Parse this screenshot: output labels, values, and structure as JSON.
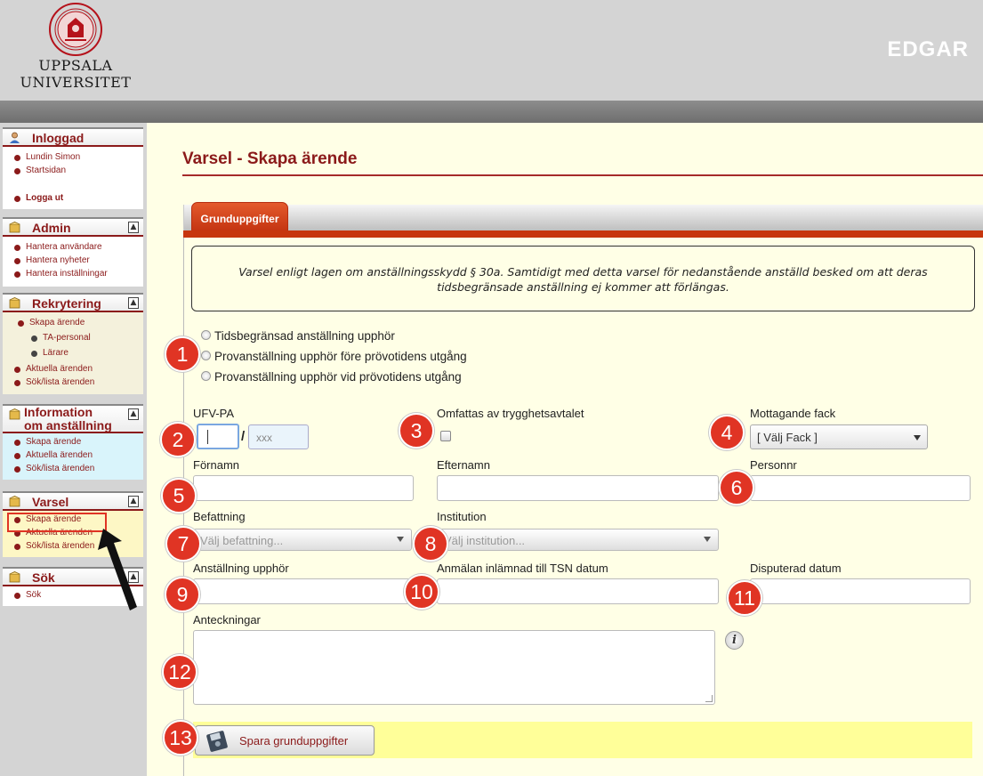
{
  "header": {
    "logo_line1": "UPPSALA",
    "logo_line2": "UNIVERSITET",
    "app_name": "EDGAR"
  },
  "sidebar": {
    "inloggad": {
      "title": "Inloggad",
      "items": [
        "Lundin Simon",
        "Startsidan",
        "Logga ut"
      ]
    },
    "admin": {
      "title": "Admin",
      "items": [
        "Hantera användare",
        "Hantera nyheter",
        "Hantera inställningar"
      ]
    },
    "rekrytering": {
      "title": "Rekrytering",
      "items": [
        "Skapa ärende",
        "TA-personal",
        "Lärare",
        "Aktuella ärenden",
        "Sök/lista ärenden"
      ]
    },
    "information": {
      "title_line1": "Information",
      "title_line2": "om anställning",
      "items": [
        "Skapa ärende",
        "Aktuella ärenden",
        "Sök/lista ärenden"
      ]
    },
    "varsel": {
      "title": "Varsel",
      "items": [
        "Skapa ärende",
        "Aktuella ärenden",
        "Sök/lista ärenden"
      ]
    },
    "sok": {
      "title": "Sök",
      "items": [
        "Sök"
      ]
    }
  },
  "page": {
    "title": "Varsel - Skapa ärende",
    "tab": "Grunduppgifter"
  },
  "notice": "Varsel enligt lagen om anställningsskydd § 30a. Samtidigt med detta varsel för nedanstående anställd besked om att deras tidsbegränsade anställning ej kommer att förlängas.",
  "radio_options": [
    "Tidsbegränsad anställning upphör",
    "Provanställning upphör före prövotidens utgång",
    "Provanställning upphör vid prövotidens utgång"
  ],
  "form": {
    "ufv_label": "UFV-PA",
    "ufv_slash": "/",
    "ufv_placeholder": "xxx",
    "trygg_label": "Omfattas av trygghetsavtalet",
    "fack_label": "Mottagande fack",
    "fack_value": "[ Välj Fack ]",
    "fornamn_label": "Förnamn",
    "efternamn_label": "Efternamn",
    "personnr_label": "Personnr",
    "befattning_label": "Befattning",
    "befattning_placeholder": "Välj befattning...",
    "institution_label": "Institution",
    "institution_placeholder": "Välj institution...",
    "upphor_label": "Anställning upphör",
    "tsn_label": "Anmälan inlämnad till TSN datum",
    "disputerad_label": "Disputerad datum",
    "notes_label": "Anteckningar",
    "info_icon": "i",
    "save_label": "Spara grunduppgifter"
  },
  "markers": [
    "1",
    "2",
    "3",
    "4",
    "5",
    "6",
    "7",
    "8",
    "9",
    "10",
    "11",
    "12",
    "13"
  ],
  "colors": {
    "accent": "#8b1a1a",
    "tab": "#c7360e",
    "marker": "#e03424",
    "background": "#ffffe6"
  }
}
